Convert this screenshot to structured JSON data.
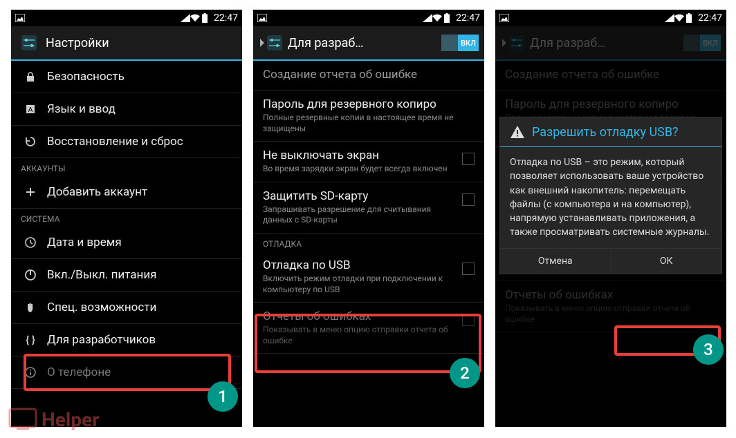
{
  "status": {
    "time": "22:47"
  },
  "screen1": {
    "title": "Настройки",
    "items": {
      "security": "Безопасность",
      "lang": "Язык и ввод",
      "backup": "Восстановление и сброс",
      "accounts_hdr": "АККАУНТЫ",
      "add_account": "Добавить аккаунт",
      "system_hdr": "СИСТЕМА",
      "datetime": "Дата и время",
      "power": "Вкл./Выкл. питания",
      "access": "Спец. возможности",
      "dev": "Для разработчиков",
      "about": "О телефоне"
    }
  },
  "screen2": {
    "title": "Для разраб…",
    "switch": "ВКЛ",
    "bugreport": "Создание отчета об ошибке",
    "backup_pw_t": "Пароль для резервного копиро",
    "backup_pw_s": "Полные резервные копии в настоящее время не защищены",
    "stayawake_t": "Не выключать экран",
    "stayawake_s": "Во время зарядки экран будет всегда включен",
    "sdcard_t": "Защитить SD-карту",
    "sdcard_s": "Запрашивать разрешение для считывания данных с SD-карты",
    "debug_hdr": "ОТЛАДКА",
    "usb_t": "Отладка по USB",
    "usb_s": "Включить режим отладки при подключении к компьютеру по USB",
    "reports_t": "Отчеты об ошибках",
    "reports_s": "Показывать в меню опцию отправки отчета об ошибке"
  },
  "dialog": {
    "title": "Разрешить отладку USB?",
    "body": "Отладка по USB – это режим, который позволяет использовать ваше устройство как внешний накопитель: перемещать файлы (с компьютера и на компьютер), напрямую устанавливать приложения, а также просматривать системные журналы.",
    "cancel": "Отмена",
    "ok": "ОК"
  },
  "badges": {
    "one": "1",
    "two": "2",
    "three": "3"
  },
  "watermark": "Helper"
}
